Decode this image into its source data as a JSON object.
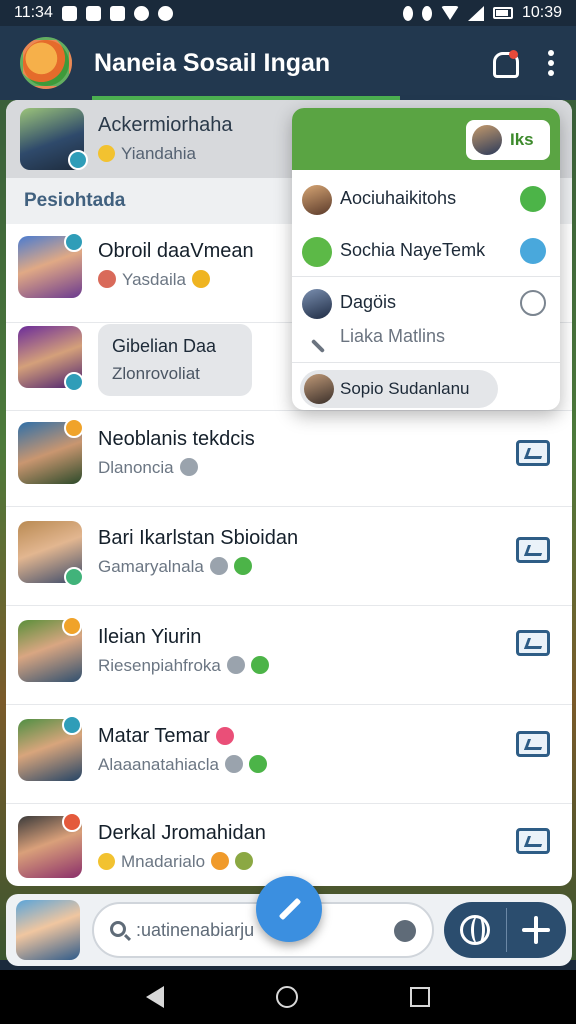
{
  "status_bar": {
    "time_left": "11:34",
    "time_right": "10:39"
  },
  "app_bar": {
    "title": "Naneia Sosail Ingan"
  },
  "profile": {
    "name": "Ackermiorhaha",
    "status": "Yiandahia"
  },
  "section": {
    "header": "Pesiohtada"
  },
  "contacts": [
    {
      "name": "Obroil daaVmean",
      "sub": "Yasdaila"
    },
    {
      "bubble_title": "Gibelian Daa",
      "bubble_sub": "Zlonrovoliat"
    },
    {
      "name": "Neoblanis tekdcis",
      "sub": "Dlanoncia"
    },
    {
      "name": "Bari Ikarlstan Sbioidan",
      "sub": "Gamaryalnala"
    },
    {
      "name": "Ileian Yiurin",
      "sub": "Riesenpiahfroka"
    },
    {
      "name": "Matar Temar",
      "sub": "Alaaanatahiacla"
    },
    {
      "name": "Derkal Jromahidan",
      "sub": "Mnadarialo"
    }
  ],
  "dropdown": {
    "chip_label": "Iks",
    "items": [
      {
        "label": "Aociuhaikitohs"
      },
      {
        "label": "Sochia NayeTemk"
      },
      {
        "label": "Dagöis",
        "sub": "Liaka Matlins"
      }
    ],
    "pill_label": "Sopio Sudanlanu"
  },
  "composer": {
    "search_value": ":uatinenabiarju"
  },
  "colors": {
    "app_bar": "#22384f",
    "accent_green": "#5aa443",
    "fab_blue": "#3b8fe0",
    "action_group": "#2b4d6e"
  }
}
